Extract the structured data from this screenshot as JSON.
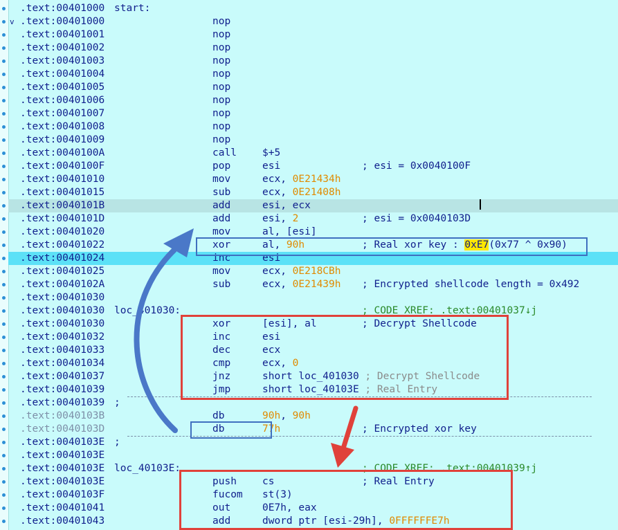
{
  "lines": [
    {
      "addr": ".text:00401000",
      "label": "start:"
    },
    {
      "addr": ".text:00401000",
      "mn": "nop",
      "fold": "v"
    },
    {
      "addr": ".text:00401001",
      "mn": "nop"
    },
    {
      "addr": ".text:00401002",
      "mn": "nop"
    },
    {
      "addr": ".text:00401003",
      "mn": "nop"
    },
    {
      "addr": ".text:00401004",
      "mn": "nop"
    },
    {
      "addr": ".text:00401005",
      "mn": "nop"
    },
    {
      "addr": ".text:00401006",
      "mn": "nop"
    },
    {
      "addr": ".text:00401007",
      "mn": "nop"
    },
    {
      "addr": ".text:00401008",
      "mn": "nop"
    },
    {
      "addr": ".text:00401009",
      "mn": "nop"
    },
    {
      "addr": ".text:0040100A",
      "mn": "call",
      "op": [
        [
          "$+5",
          ""
        ]
      ]
    },
    {
      "addr": ".text:0040100F",
      "mn": "pop",
      "op": [
        [
          "esi",
          ""
        ]
      ],
      "cm": [
        [
          "; esi = 0x0040100F",
          "cmt"
        ]
      ]
    },
    {
      "addr": ".text:00401010",
      "mn": "mov",
      "op": [
        [
          "ecx, ",
          ""
        ],
        [
          "0E21434h",
          "num"
        ]
      ]
    },
    {
      "addr": ".text:00401015",
      "mn": "sub",
      "op": [
        [
          "ecx, ",
          ""
        ],
        [
          "0E21408h",
          "num"
        ]
      ]
    },
    {
      "addr": ".text:0040101B",
      "mn": "add",
      "op": [
        [
          "esi, ecx",
          ""
        ]
      ],
      "state": "sel"
    },
    {
      "addr": ".text:0040101D",
      "mn": "add",
      "op": [
        [
          "esi, ",
          ""
        ],
        [
          "2",
          "num"
        ]
      ],
      "cm": [
        [
          "; esi = 0x0040103D",
          "cmt"
        ]
      ]
    },
    {
      "addr": ".text:00401020",
      "mn": "mov",
      "op": [
        [
          "al, [esi]",
          ""
        ]
      ]
    },
    {
      "addr": ".text:00401022",
      "mn": "xor",
      "op": [
        [
          "al, ",
          ""
        ],
        [
          "90h",
          "num"
        ]
      ],
      "cm": [
        [
          "; Real xor key : ",
          "cmt"
        ],
        [
          "0xE7",
          "hl"
        ],
        [
          "(0x77 ^ 0x90)",
          "cmt"
        ]
      ]
    },
    {
      "addr": ".text:00401024",
      "mn": "inc",
      "op": [
        [
          "esi",
          ""
        ]
      ],
      "state": "cur"
    },
    {
      "addr": ".text:00401025",
      "mn": "mov",
      "op": [
        [
          "ecx, ",
          ""
        ],
        [
          "0E218CBh",
          "num"
        ]
      ]
    },
    {
      "addr": ".text:0040102A",
      "mn": "sub",
      "op": [
        [
          "ecx, ",
          ""
        ],
        [
          "0E21439h",
          "num"
        ]
      ],
      "cm": [
        [
          "; Encrypted shellcode length = 0x492",
          "cmt"
        ]
      ]
    },
    {
      "addr": ".text:00401030"
    },
    {
      "addr": ".text:00401030",
      "label": "loc_401030:",
      "cm": [
        [
          "; CODE XREF: .text:00401037↓j",
          "xref"
        ]
      ]
    },
    {
      "addr": ".text:00401030",
      "mn": "xor",
      "op": [
        [
          "[esi], al",
          ""
        ]
      ],
      "cm": [
        [
          "; Decrypt Shellcode",
          "cmt"
        ]
      ]
    },
    {
      "addr": ".text:00401032",
      "mn": "inc",
      "op": [
        [
          "esi",
          ""
        ]
      ]
    },
    {
      "addr": ".text:00401033",
      "mn": "dec",
      "op": [
        [
          "ecx",
          ""
        ]
      ]
    },
    {
      "addr": ".text:00401034",
      "mn": "cmp",
      "op": [
        [
          "ecx, ",
          ""
        ],
        [
          "0",
          "num"
        ]
      ]
    },
    {
      "addr": ".text:00401037",
      "mn": "jnz",
      "op": [
        [
          "short loc_401030 ",
          ""
        ],
        [
          "; Decrypt Shellcode",
          "cmt-grey"
        ]
      ]
    },
    {
      "addr": ".text:00401039",
      "mn": "jmp",
      "op": [
        [
          "short loc_40103E ",
          ""
        ],
        [
          "; Real Entry",
          "cmt-grey"
        ]
      ]
    },
    {
      "addr": ".text:00401039",
      "label": ";",
      "sep": true
    },
    {
      "addr": ".text:0040103B",
      "mn": "db",
      "op": [
        [
          "90h",
          "num"
        ],
        [
          ", ",
          ""
        ],
        [
          "90h",
          "num"
        ]
      ],
      "grey": true
    },
    {
      "addr": ".text:0040103D",
      "mn": "db",
      "op": [
        [
          "77h",
          "num"
        ]
      ],
      "cm": [
        [
          "; Encrypted xor key",
          "cmt"
        ]
      ],
      "grey": true
    },
    {
      "addr": ".text:0040103E",
      "label": ";",
      "sep": true
    },
    {
      "addr": ".text:0040103E"
    },
    {
      "addr": ".text:0040103E",
      "label": "loc_40103E:",
      "cm": [
        [
          "; CODE XREF: .text:00401039↑j",
          "xref"
        ]
      ]
    },
    {
      "addr": ".text:0040103E",
      "mn": "push",
      "op": [
        [
          "cs",
          ""
        ]
      ],
      "cm": [
        [
          "; Real Entry",
          "cmt"
        ]
      ]
    },
    {
      "addr": ".text:0040103F",
      "mn": "fucom",
      "op": [
        [
          "st(3)",
          ""
        ]
      ]
    },
    {
      "addr": ".text:00401041",
      "mn": "out",
      "op": [
        [
          "0E7h, eax",
          ""
        ]
      ]
    },
    {
      "addr": ".text:00401043",
      "mn": "add",
      "op": [
        [
          "dword ptr [esi-29h], ",
          ""
        ],
        [
          "0FFFFFFE7h",
          "num"
        ]
      ]
    }
  ],
  "icons": {
    "fold": "chevron-down-icon",
    "flow_arrow_blue": "curved-arrow-icon",
    "flow_arrow_red": "arrow-down-icon"
  },
  "colors": {
    "background": "#c9fbfb",
    "selected_line": "#b8e4e4",
    "current_line": "#5ce1f7",
    "number": "#e08a00",
    "highlight": "#ffe800",
    "annotation_blue": "#3f6fbf",
    "annotation_red": "#e0413a"
  }
}
